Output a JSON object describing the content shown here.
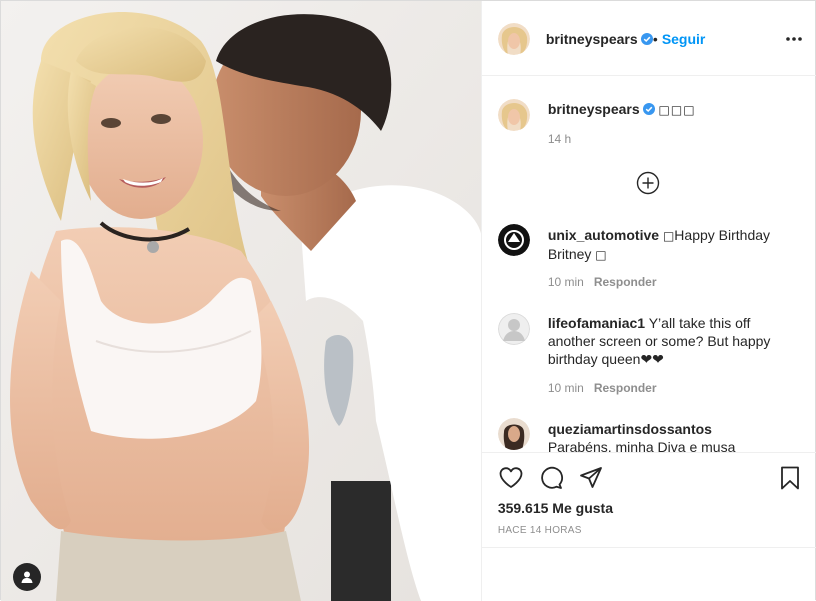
{
  "post": {
    "author": "britneyspears",
    "follow_separator": "•",
    "follow_label": "Seguir",
    "caption": "",
    "caption_time": "14 h",
    "likes": "359.615 Me gusta",
    "posted": "HACE 14 HORAS"
  },
  "comments": [
    {
      "user": "unix_automotive",
      "text": "Happy Birthday Britney",
      "time": "10 min",
      "reply": "Responder"
    },
    {
      "user": "lifeofamaniac1",
      "text": "Y’all take this off another screen or some? But happy birthday queen❤❤",
      "time": "10 min",
      "reply": "Responder"
    },
    {
      "user": "queziamartinsdossantos",
      "text": "Parabéns, minha Diva e musa inspiradora, meu",
      "time": "",
      "reply": ""
    }
  ],
  "icons": {
    "more": "more-horizontal-icon",
    "load_more": "plus-circle-icon",
    "like": "heart-icon",
    "comment": "comment-bubble-icon",
    "share": "paper-plane-icon",
    "save": "bookmark-icon",
    "user_tags": "person-icon",
    "verified": "verified-badge-icon"
  },
  "colors": {
    "link_blue": "#0095f6",
    "verified_blue": "#3897f0",
    "text": "#262626",
    "muted": "#8e8e8e"
  }
}
